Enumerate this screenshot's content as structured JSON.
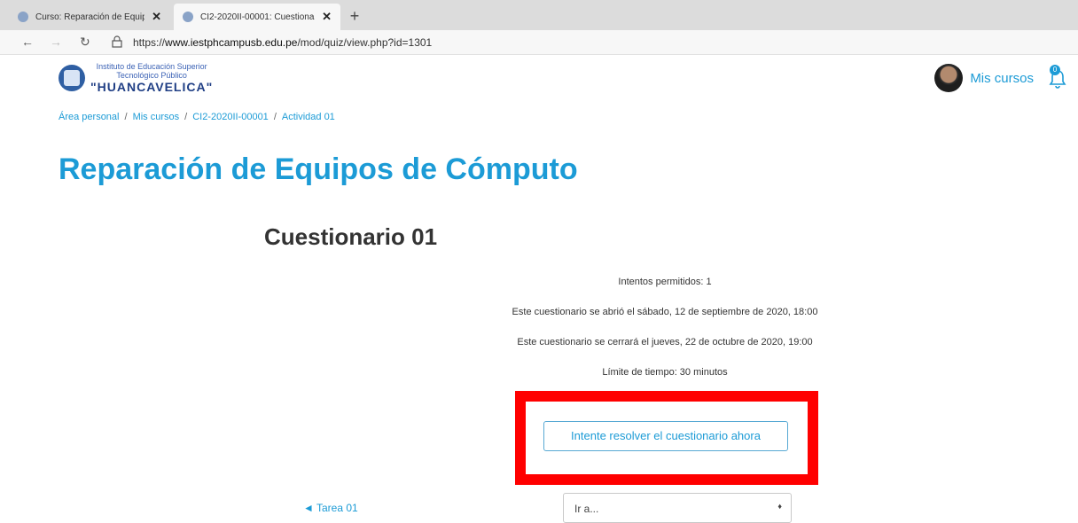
{
  "browser": {
    "tabs": [
      {
        "title": "Curso: Reparación de Equipos d",
        "active": false
      },
      {
        "title": "CI2-2020II-00001: Cuestionario",
        "active": true
      }
    ],
    "new_tab": "+",
    "url_prefix": "https://",
    "url_domain": "www.iestphcampusb.edu.pe",
    "url_path": "/mod/quiz/view.php?id=1301"
  },
  "header": {
    "logo_line1": "Instituto de Educación Superior",
    "logo_line2": "Tecnológico Público",
    "logo_name": "\"HUANCAVELICA\"",
    "mis_cursos": "Mis cursos",
    "notification_count": "0"
  },
  "breadcrumb": [
    "Área personal",
    "Mis cursos",
    "CI2-2020II-00001",
    "Actividad 01"
  ],
  "page_title": "Reparación de Equipos de Cómputo",
  "quiz": {
    "title": "Cuestionario 01",
    "attempts": "Intentos permitidos: 1",
    "opened": "Este cuestionario se abrió el sábado, 12 de septiembre de 2020, 18:00",
    "closes": "Este cuestionario se cerrará el jueves, 22 de octubre de 2020, 19:00",
    "time_limit": "Límite de tiempo: 30 minutos",
    "start_button": "Intente resolver el cuestionario ahora"
  },
  "footer_nav": {
    "prev_link": "◄ Tarea 01",
    "jump_value": "Ir a...",
    "jump_arrow": "♦"
  },
  "colors": {
    "accent": "#1c9bd6",
    "highlight": "#ff0000"
  }
}
